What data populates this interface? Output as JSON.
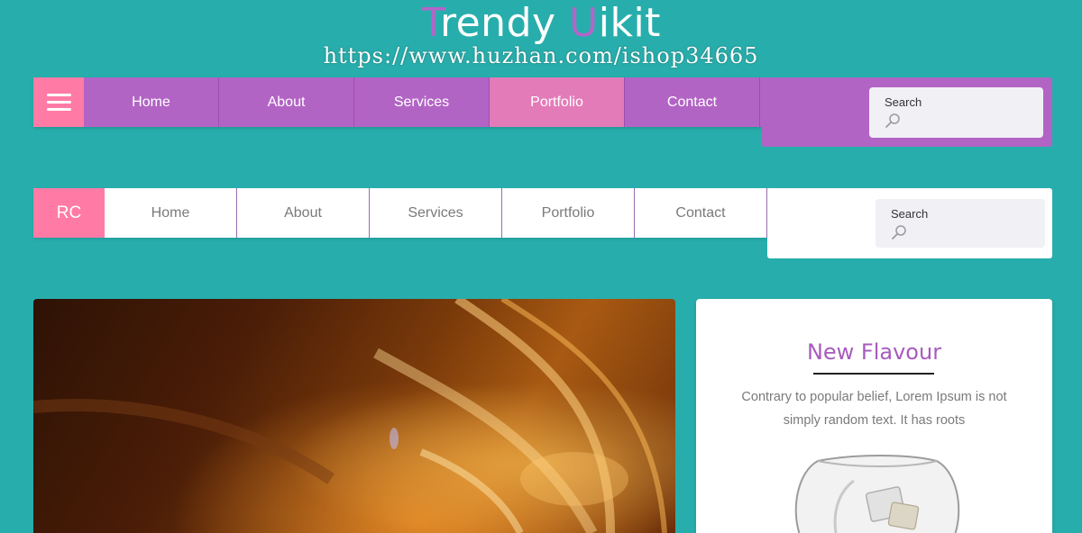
{
  "header": {
    "title_first_letter": "T",
    "title_rest_1": "rendy ",
    "title_accent_letter": "U",
    "title_rest_2": "ikit",
    "watermark_text": "https://www.huzhan.com/ishop34665"
  },
  "nav_purple": {
    "menu_icon": "hamburger-menu-icon",
    "items": [
      {
        "label": "Home"
      },
      {
        "label": "About"
      },
      {
        "label": "Services"
      },
      {
        "label": "Portfolio"
      },
      {
        "label": "Contact"
      }
    ],
    "active_item": "Portfolio",
    "search": {
      "label": "Search",
      "icon": "search-icon"
    }
  },
  "nav_white": {
    "logo_text": "RC",
    "items": [
      {
        "label": "Home"
      },
      {
        "label": "About"
      },
      {
        "label": "Services"
      },
      {
        "label": "Portfolio"
      },
      {
        "label": "Contact"
      }
    ],
    "search": {
      "label": "Search",
      "icon": "search-icon"
    }
  },
  "card": {
    "title": "New Flavour",
    "text": "Contrary to popular belief, Lorem Ipsum is not simply random text. It has roots"
  },
  "colors": {
    "background": "#27aeac",
    "purple": "#b264c5",
    "pink": "#ff7ba6",
    "active_tab": "#e47bb9",
    "card_title": "#a75bbd"
  }
}
